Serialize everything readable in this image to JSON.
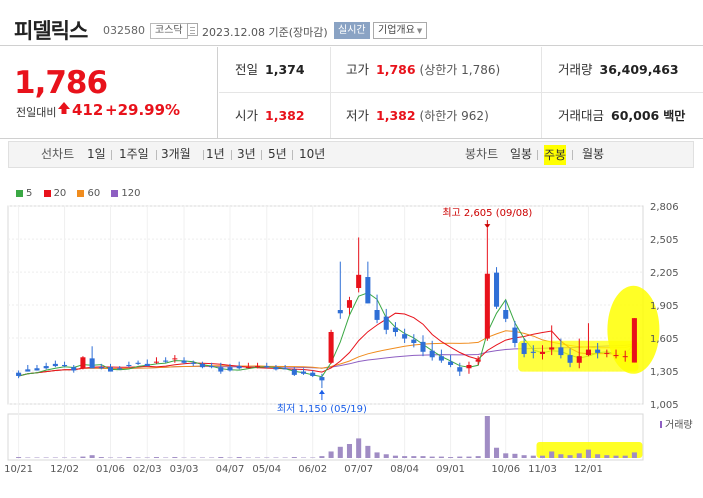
{
  "header": {
    "name": "피델릭스",
    "code": "032580",
    "market": "코스닥",
    "date": "2023.12.08 기준(장마감)",
    "realtime_label": "실시간",
    "company_label": "기업개요"
  },
  "price": {
    "current": "1,786",
    "change_label": "전일대비",
    "change": "412",
    "change_pct": "+29.99%",
    "color_up": "#e8121b",
    "color_down": "#1a5ee8"
  },
  "summary": {
    "prev_close_label": "전일",
    "prev_close": "1,374",
    "high_label": "고가",
    "high": "1,786",
    "high_note": "(상한가 1,786)",
    "volume_label": "거래량",
    "volume": "36,409,463",
    "open_label": "시가",
    "open": "1,382",
    "low_label": "저가",
    "low": "1,382",
    "low_note": "(하한가 962)",
    "amount_label": "거래대금",
    "amount": "60,006",
    "amount_unit": "백만"
  },
  "period_bar": {
    "line_label": "선차트",
    "line_periods": [
      "1일",
      "1주일",
      "3개월",
      "1년",
      "3년",
      "5년",
      "10년"
    ],
    "candle_label": "봉차트",
    "candle_periods": [
      "일봉",
      "주봉",
      "월봉"
    ],
    "selected": "주봉"
  },
  "chart_data": {
    "type": "line",
    "title": "",
    "candle": "weekly",
    "legend": [
      {
        "name": "5",
        "color": "#3aa844"
      },
      {
        "name": "20",
        "color": "#e8121b"
      },
      {
        "name": "60",
        "color": "#f08c1e"
      },
      {
        "name": "120",
        "color": "#8e5fc2"
      }
    ],
    "y_ticks": [
      "2,806",
      "2,505",
      "2,205",
      "1,905",
      "1,605",
      "1,305",
      "1,005"
    ],
    "ylim": [
      1005,
      2806
    ],
    "x_ticks": [
      "10/21",
      "12/02",
      "01/06",
      "02/03",
      "03/03",
      "04/07",
      "05/04",
      "06/02",
      "07/07",
      "08/04",
      "09/01",
      "10/06",
      "11/03",
      "12/01"
    ],
    "high_annotation": "최고 2,605 (09/08)",
    "low_annotation": "최저 1,150 (05/19)",
    "volume_label": "거래량",
    "candles": [
      [
        1290,
        1310,
        1240,
        1260
      ],
      [
        1320,
        1360,
        1300,
        1300
      ],
      [
        1330,
        1360,
        1310,
        1310
      ],
      [
        1350,
        1380,
        1320,
        1330
      ],
      [
        1370,
        1400,
        1340,
        1350
      ],
      [
        1360,
        1390,
        1340,
        1350
      ],
      [
        1340,
        1360,
        1290,
        1310
      ],
      [
        1330,
        1440,
        1320,
        1430
      ],
      [
        1420,
        1530,
        1400,
        1330
      ],
      [
        1340,
        1370,
        1320,
        1330
      ],
      [
        1340,
        1370,
        1300,
        1300
      ],
      [
        1330,
        1350,
        1320,
        1320
      ],
      [
        1360,
        1390,
        1340,
        1350
      ],
      [
        1380,
        1400,
        1360,
        1370
      ],
      [
        1370,
        1410,
        1350,
        1350
      ],
      [
        1390,
        1430,
        1370,
        1390
      ],
      [
        1400,
        1430,
        1380,
        1390
      ],
      [
        1420,
        1450,
        1380,
        1420
      ],
      [
        1400,
        1430,
        1370,
        1380
      ],
      [
        1380,
        1400,
        1350,
        1370
      ],
      [
        1370,
        1390,
        1330,
        1340
      ],
      [
        1350,
        1380,
        1330,
        1340
      ],
      [
        1340,
        1380,
        1280,
        1300
      ],
      [
        1340,
        1370,
        1300,
        1310
      ],
      [
        1350,
        1390,
        1320,
        1330
      ],
      [
        1340,
        1380,
        1330,
        1340
      ],
      [
        1350,
        1380,
        1330,
        1350
      ],
      [
        1350,
        1380,
        1330,
        1340
      ],
      [
        1340,
        1360,
        1310,
        1320
      ],
      [
        1330,
        1360,
        1320,
        1320
      ],
      [
        1320,
        1340,
        1260,
        1270
      ],
      [
        1300,
        1330,
        1270,
        1280
      ],
      [
        1290,
        1310,
        1250,
        1260
      ],
      [
        1250,
        1280,
        1150,
        1220
      ],
      [
        1380,
        1680,
        1370,
        1660
      ],
      [
        1860,
        2300,
        1780,
        1830
      ],
      [
        1880,
        1980,
        1820,
        1950
      ],
      [
        2060,
        2520,
        2020,
        2180
      ],
      [
        2160,
        2300,
        1920,
        1920
      ],
      [
        1860,
        2000,
        1740,
        1770
      ],
      [
        1800,
        1870,
        1640,
        1680
      ],
      [
        1700,
        1750,
        1620,
        1660
      ],
      [
        1640,
        1690,
        1560,
        1600
      ],
      [
        1590,
        1640,
        1520,
        1560
      ],
      [
        1570,
        1630,
        1440,
        1480
      ],
      [
        1490,
        1580,
        1400,
        1430
      ],
      [
        1440,
        1500,
        1380,
        1400
      ],
      [
        1390,
        1450,
        1340,
        1360
      ],
      [
        1340,
        1380,
        1260,
        1300
      ],
      [
        1330,
        1390,
        1280,
        1360
      ],
      [
        1390,
        1440,
        1360,
        1410
      ],
      [
        1600,
        2605,
        1580,
        2190
      ],
      [
        2200,
        2250,
        1870,
        1890
      ],
      [
        1860,
        1950,
        1750,
        1780
      ],
      [
        1700,
        1760,
        1520,
        1560
      ],
      [
        1560,
        1600,
        1430,
        1460
      ],
      [
        1480,
        1540,
        1420,
        1470
      ],
      [
        1460,
        1540,
        1410,
        1480
      ],
      [
        1500,
        1720,
        1450,
        1520
      ],
      [
        1520,
        1600,
        1420,
        1450
      ],
      [
        1450,
        1510,
        1340,
        1380
      ],
      [
        1380,
        1600,
        1330,
        1440
      ],
      [
        1450,
        1740,
        1440,
        1500
      ],
      [
        1500,
        1560,
        1420,
        1470
      ],
      [
        1470,
        1500,
        1430,
        1470
      ],
      [
        1450,
        1500,
        1420,
        1450
      ],
      [
        1440,
        1490,
        1390,
        1440
      ],
      [
        1382,
        1786,
        1382,
        1786
      ]
    ],
    "volume": [
      2,
      1,
      1,
      1,
      1,
      1,
      1,
      3,
      6,
      2,
      1,
      1,
      2,
      1,
      1,
      2,
      1,
      2,
      1,
      1,
      1,
      1,
      2,
      1,
      2,
      1,
      1,
      1,
      1,
      1,
      2,
      1,
      1,
      4,
      14,
      24,
      30,
      42,
      26,
      12,
      8,
      5,
      4,
      4,
      4,
      3,
      3,
      2,
      3,
      3,
      4,
      90,
      22,
      10,
      9,
      6,
      5,
      5,
      14,
      8,
      6,
      10,
      18,
      8,
      6,
      5,
      5,
      12
    ]
  }
}
